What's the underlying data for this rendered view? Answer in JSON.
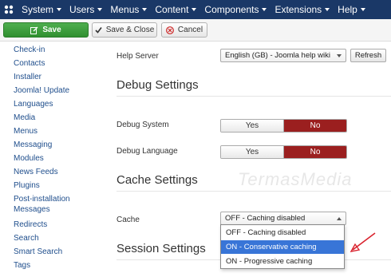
{
  "nav": {
    "items": [
      {
        "label": "System"
      },
      {
        "label": "Users"
      },
      {
        "label": "Menus"
      },
      {
        "label": "Content"
      },
      {
        "label": "Components"
      },
      {
        "label": "Extensions"
      },
      {
        "label": "Help"
      }
    ]
  },
  "toolbar": {
    "save_label": "Save",
    "save_close_label": "Save & Close",
    "cancel_label": "Cancel"
  },
  "sidebar": {
    "items": [
      {
        "label": "Check-in"
      },
      {
        "label": "Contacts"
      },
      {
        "label": "Installer"
      },
      {
        "label": "Joomla! Update"
      },
      {
        "label": "Languages"
      },
      {
        "label": "Media"
      },
      {
        "label": "Menus"
      },
      {
        "label": "Messaging"
      },
      {
        "label": "Modules"
      },
      {
        "label": "News Feeds"
      },
      {
        "label": "Plugins"
      },
      {
        "label": "Post-installation Messages"
      },
      {
        "label": "Redirects"
      },
      {
        "label": "Search"
      },
      {
        "label": "Smart Search"
      },
      {
        "label": "Tags"
      }
    ]
  },
  "help": {
    "label": "Help Server",
    "select_value": "English (GB) - Joomla help wiki",
    "refresh_label": "Refresh"
  },
  "debug": {
    "title": "Debug Settings",
    "system": {
      "label": "Debug System",
      "yes": "Yes",
      "no": "No"
    },
    "language": {
      "label": "Debug Language",
      "yes": "Yes",
      "no": "No"
    }
  },
  "cache": {
    "title": "Cache Settings",
    "label": "Cache",
    "select_value": "OFF - Caching disabled",
    "options": [
      {
        "label": "OFF - Caching disabled"
      },
      {
        "label": "ON - Conservative caching"
      },
      {
        "label": "ON - Progressive caching"
      }
    ]
  },
  "session": {
    "title": "Session Settings"
  },
  "watermark": "TermasMedia",
  "colors": {
    "navbar": "#1a3867",
    "save": "#3c9c3c",
    "no_active": "#9b1f1f",
    "selected_option": "#3875d7",
    "annotation_arrow": "#d9232e"
  }
}
